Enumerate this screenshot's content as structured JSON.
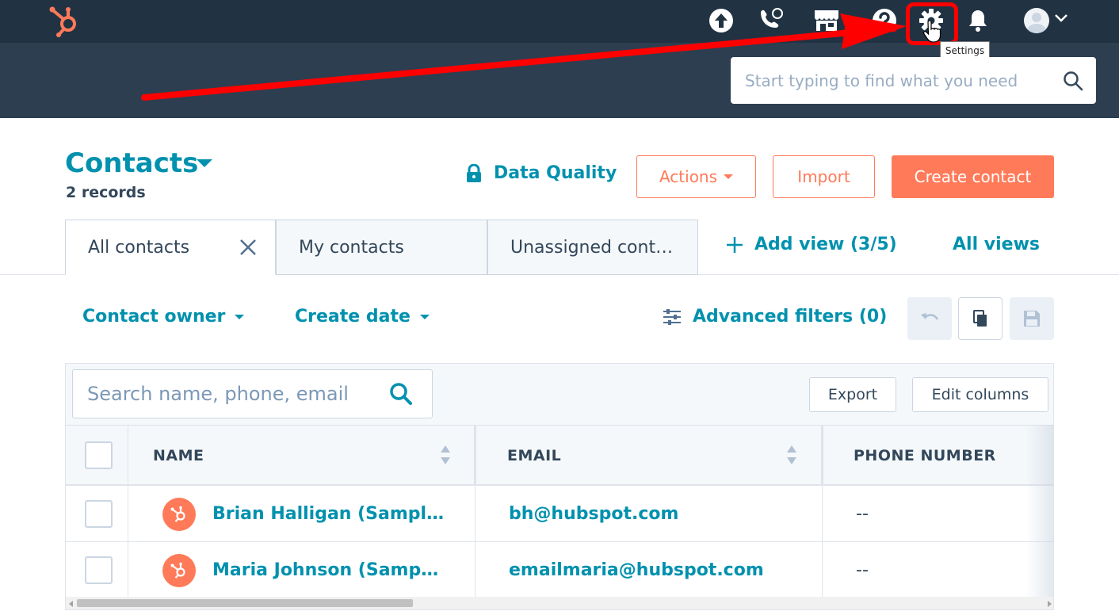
{
  "topnav": {
    "search_placeholder": "Start typing to find what you need",
    "settings_tooltip": "Settings"
  },
  "header": {
    "title": "Contacts",
    "record_count": "2 records",
    "data_quality": "Data Quality",
    "actions_label": "Actions",
    "import_label": "Import",
    "create_label": "Create contact"
  },
  "tabs": [
    {
      "label": "All contacts",
      "active": true
    },
    {
      "label": "My contacts",
      "active": false
    },
    {
      "label": "Unassigned cont…",
      "active": false
    }
  ],
  "views": {
    "add_view": "Add view (3/5)",
    "all_views": "All views"
  },
  "filters": {
    "contact_owner": "Contact owner",
    "create_date": "Create date",
    "advanced": "Advanced filters (0)"
  },
  "table": {
    "search_placeholder": "Search name, phone, email",
    "export_label": "Export",
    "edit_columns_label": "Edit columns",
    "columns": [
      "NAME",
      "EMAIL",
      "PHONE NUMBER"
    ],
    "rows": [
      {
        "name": "Brian Halligan (Sampl…",
        "email": "bh@hubspot.com",
        "phone": "--"
      },
      {
        "name": "Maria Johnson (Samp…",
        "email": "emailmaria@hubspot.com",
        "phone": "--"
      }
    ]
  },
  "colors": {
    "brand_orange": "#ff7a59",
    "link_teal": "#0091ae",
    "nav_dark": "#213343",
    "annotation_red": "#ff0000"
  }
}
